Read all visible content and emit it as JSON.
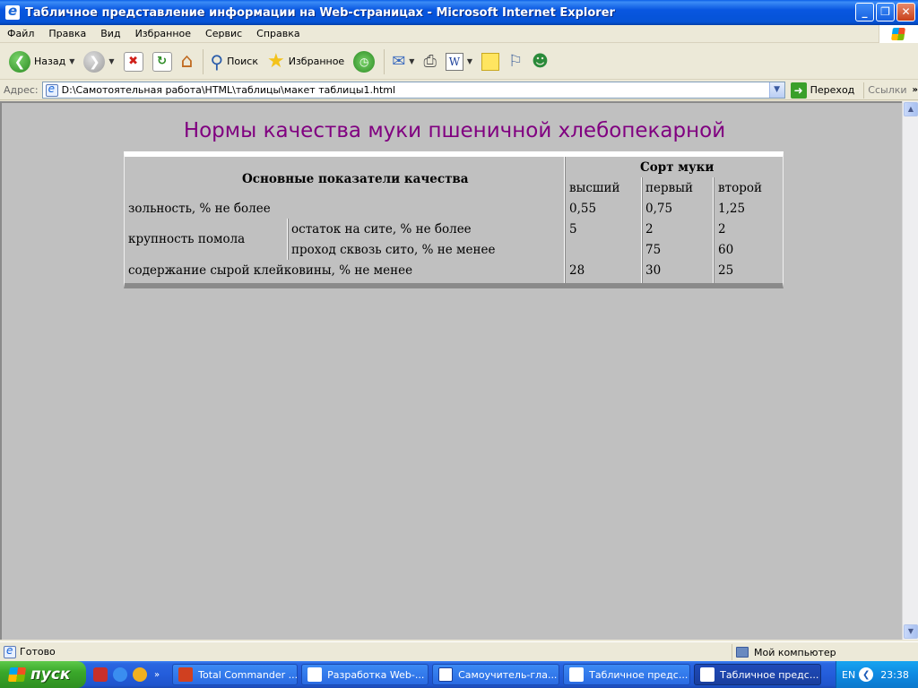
{
  "window": {
    "title": "Табличное представление информации на Web-страницах - Microsoft Internet Explorer"
  },
  "menu": [
    "Файл",
    "Правка",
    "Вид",
    "Избранное",
    "Сервис",
    "Справка"
  ],
  "toolbar": {
    "back_label": "Назад",
    "search_label": "Поиск",
    "favorites_label": "Избранное"
  },
  "address": {
    "label": "Адрес:",
    "value": "D:\\Самотоятельная работа\\HTML\\таблицы\\макет таблицы1.html",
    "go_label": "Переход",
    "links_label": "Ссылки"
  },
  "page": {
    "heading": "Нормы качества муки пшеничной хлебопекарной",
    "table": {
      "main_header": "Основные показатели качества",
      "grade_header": "Сорт муки",
      "grades": [
        "высший",
        "первый",
        "второй"
      ],
      "rows": {
        "ash": {
          "label": "зольность, % не более",
          "values": [
            "0,55",
            "0,75",
            "1,25"
          ]
        },
        "grind_label": "крупность помола",
        "residue": {
          "label": "остаток на сите, % не более",
          "values": [
            "5",
            "2",
            "2"
          ]
        },
        "passage": {
          "label": "проход сквозь сито, % не менее",
          "values": [
            "",
            "75",
            "60"
          ]
        },
        "gluten": {
          "label": "содержание сырой клейковины, % не менее",
          "values": [
            "28",
            "30",
            "25"
          ]
        }
      }
    }
  },
  "status": {
    "text": "Готово",
    "zone": "Мой компьютер"
  },
  "taskbar": {
    "start_label": "пуск",
    "tasks": [
      "Total Commander ...",
      "Разработка Web-...",
      "Самоучитель-гла...",
      "Табличное предс...",
      "Табличное предс..."
    ],
    "lang": "EN",
    "clock": "23:38"
  },
  "colors": {
    "heading": "#800080",
    "page_background": "#c0c0c0",
    "titlebar": "#0553d6",
    "taskbar": "#245ddb"
  }
}
